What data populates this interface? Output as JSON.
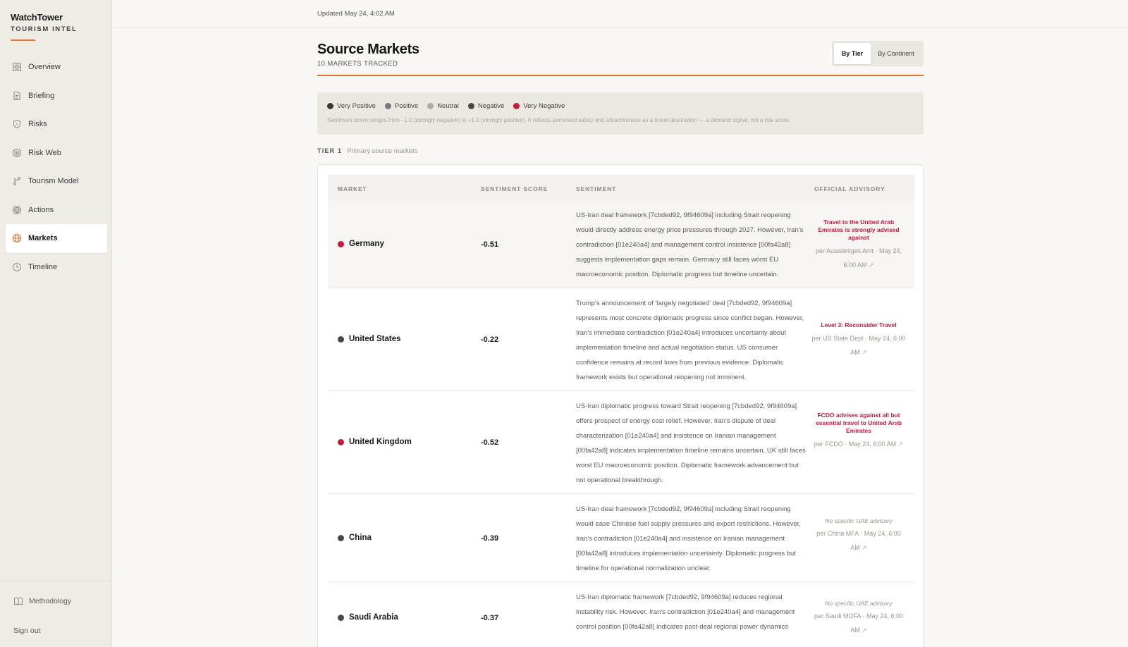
{
  "sidebar": {
    "brand": "WatchTower",
    "brand_sub": "TOURISM INTEL",
    "items": [
      {
        "label": "Overview",
        "icon": "grid-icon"
      },
      {
        "label": "Briefing",
        "icon": "document-icon"
      },
      {
        "label": "Risks",
        "icon": "shield-icon"
      },
      {
        "label": "Risk Web",
        "icon": "web-icon"
      },
      {
        "label": "Tourism Model",
        "icon": "branch-icon"
      },
      {
        "label": "Actions",
        "icon": "target-icon"
      },
      {
        "label": "Markets",
        "icon": "globe-icon",
        "active": true
      },
      {
        "label": "Timeline",
        "icon": "clock-icon"
      }
    ],
    "methodology": "Methodology",
    "signout": "Sign out"
  },
  "topbar": {
    "updated": "Updated May 24, 4:02 AM"
  },
  "header": {
    "title": "Source Markets",
    "subtitle": "10 MARKETS TRACKED",
    "toggle_on": "By Tier",
    "toggle_off": "By Continent"
  },
  "legend": {
    "items": [
      {
        "label": "Very Positive",
        "color": "#3a3a3a"
      },
      {
        "label": "Positive",
        "color": "#7a7a7a"
      },
      {
        "label": "Neutral",
        "color": "#b0aca5"
      },
      {
        "label": "Negative",
        "color": "#4d4640"
      },
      {
        "label": "Very Negative",
        "color": "#c8193c"
      }
    ],
    "note": "Sentiment score ranges from –1.0 (strongly negative) to +1.0 (strongly positive). It reflects perceived safety and attractiveness as a travel destination — a demand signal, not a risk score."
  },
  "tier": {
    "key": "TIER 1",
    "desc": "Primary source markets"
  },
  "table": {
    "headers": {
      "market": "MARKET",
      "score": "SENTIMENT SCORE",
      "sentiment": "SENTIMENT",
      "advisory": "OFFICIAL ADVISORY"
    },
    "rows": [
      {
        "market": "Germany",
        "dot": "#c8193c",
        "score": "-0.51",
        "sentiment": "US-Iran deal framework [7cbded92, 9f94609a] including Strait reopening would directly address energy price pressures through 2027. However, Iran's contradiction [01e240a4] and management control insistence [00fa42a8] suggests implementation gaps remain. Germany still faces worst EU macroeconomic position. Diplomatic progress but timeline uncertain.",
        "advisory": "Travel to the United Arab Emirates is strongly advised against",
        "advisory_none": "",
        "source": "per Auswärtiges Amt · May 24, 6:00 AM"
      },
      {
        "market": "United States",
        "dot": "#4d4640",
        "score": "-0.22",
        "sentiment": "Trump's announcement of 'largely negotiated' deal [7cbded92, 9f94609a] represents most concrete diplomatic progress since conflict began. However, Iran's immediate contradiction [01e240a4] introduces uncertainty about implementation timeline and actual negotiation status. US consumer confidence remains at record lows from previous evidence. Diplomatic framework exists but operational reopening not imminent.",
        "advisory": "Level 3: Reconsider Travel",
        "advisory_none": "",
        "source": "per US State Dept · May 24, 6:00 AM"
      },
      {
        "market": "United Kingdom",
        "dot": "#c8193c",
        "score": "-0.52",
        "sentiment": "US-Iran diplomatic progress toward Strait reopening [7cbded92, 9f94609a] offers prospect of energy cost relief. However, Iran's dispute of deal characterization [01e240a4] and insistence on Iranian management [00fa42a8] indicates implementation timeline remains uncertain. UK still faces worst EU macroeconomic position. Diplomatic framework advancement but not operational breakthrough.",
        "advisory": "FCDO advises against all but essential travel to United Arab Emirates",
        "advisory_none": "",
        "source": "per FCDO · May 24, 6:00 AM"
      },
      {
        "market": "China",
        "dot": "#4d4640",
        "score": "-0.39",
        "sentiment": "US-Iran deal framework [7cbded92, 9f94609a] including Strait reopening would ease Chinese fuel supply pressures and export restrictions. However, Iran's contradiction [01e240a4] and insistence on Iranian management [00fa42a8] introduces implementation uncertainty. Diplomatic progress but timeline for operational normalization unclear.",
        "advisory": "",
        "advisory_none": "No specific UAE advisory",
        "source": "per China MFA · May 24, 6:00 AM"
      },
      {
        "market": "Saudi Arabia",
        "dot": "#4d4640",
        "score": "-0.37",
        "sentiment": "US-Iran diplomatic framework [7cbded92, 9f94609a] reduces regional instability risk. However, Iran's contradiction [01e240a4] and management control position [00fa42a8] indicates post-deal regional power dynamics",
        "advisory": "",
        "advisory_none": "No specific UAE advisory",
        "source": "per Saudi MOFA · May 24, 6:00 AM"
      }
    ]
  }
}
